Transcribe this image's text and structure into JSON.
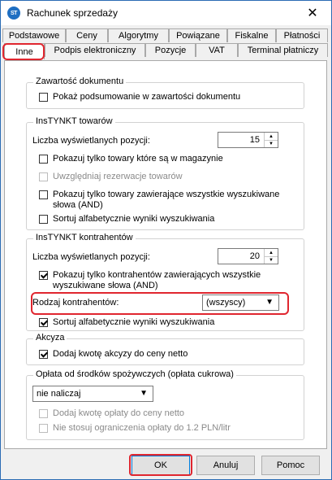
{
  "window": {
    "title": "Rachunek sprzedaży",
    "app_icon": "app-logo-icon",
    "close": "close-icon"
  },
  "tabs_row1": [
    "Podstawowe",
    "Ceny",
    "Algorytmy",
    "Powiązane",
    "Fiskalne",
    "Płatności"
  ],
  "tabs_row2": [
    "Inne",
    "Podpis elektroniczny",
    "Pozycje",
    "VAT",
    "Terminal płatniczy"
  ],
  "active_tab": "Inne",
  "groups": {
    "zawartosc": {
      "legend": "Zawartość dokumentu",
      "show_summary": {
        "label": "Pokaż podsumowanie w zawartości dokumentu",
        "checked": false
      }
    },
    "instynkt_towarow": {
      "legend": "InsTYNKT towarów",
      "count_label": "Liczba wyświetlanych pozycji:",
      "count_value": "15",
      "only_in_stock": {
        "label": "Pokazuj tylko towary które są w magazynie",
        "checked": false
      },
      "reservations": {
        "label": "Uwzględniaj rezerwacje towarów",
        "checked": false,
        "disabled": true
      },
      "all_words_line1": "Pokazuj tylko towary zawierające wszystkie wyszukiwane",
      "all_words_line2": "słowa (AND)",
      "all_words_checked": false,
      "sort": {
        "label": "Sortuj alfabetycznie wyniki wyszukiwania",
        "checked": false
      }
    },
    "instynkt_kontrahentow": {
      "legend": "InsTYNKT kontrahentów",
      "count_label": "Liczba wyświetlanych pozycji:",
      "count_value": "20",
      "all_words_line1": "Pokazuj tylko kontrahentów zawierających wszystkie",
      "all_words_line2": "wyszukiwane słowa (AND)",
      "all_words_checked": true,
      "type_label": "Rodzaj kontrahentów:",
      "type_value": "(wszyscy)",
      "sort": {
        "label": "Sortuj alfabetycznie wyniki wyszukiwania",
        "checked": true
      }
    },
    "akcyza": {
      "legend": "Akcyza",
      "add_excise": {
        "label": "Dodaj kwotę akcyzy do ceny netto",
        "checked": true
      }
    },
    "oplata": {
      "legend": "Opłata od środków spożywczych (opłata cukrowa)",
      "select_value": "nie naliczaj",
      "add_fee": {
        "label": "Dodaj kwotę opłaty do ceny netto",
        "checked": false,
        "disabled": true
      },
      "no_limit": {
        "label": "Nie stosuj ograniczenia opłaty do 1.2 PLN/litr",
        "checked": false,
        "disabled": true
      }
    }
  },
  "buttons": {
    "ok": "OK",
    "cancel": "Anuluj",
    "help": "Pomoc"
  },
  "colors": {
    "highlight": "#e0262f",
    "accent": "#0078d7"
  }
}
